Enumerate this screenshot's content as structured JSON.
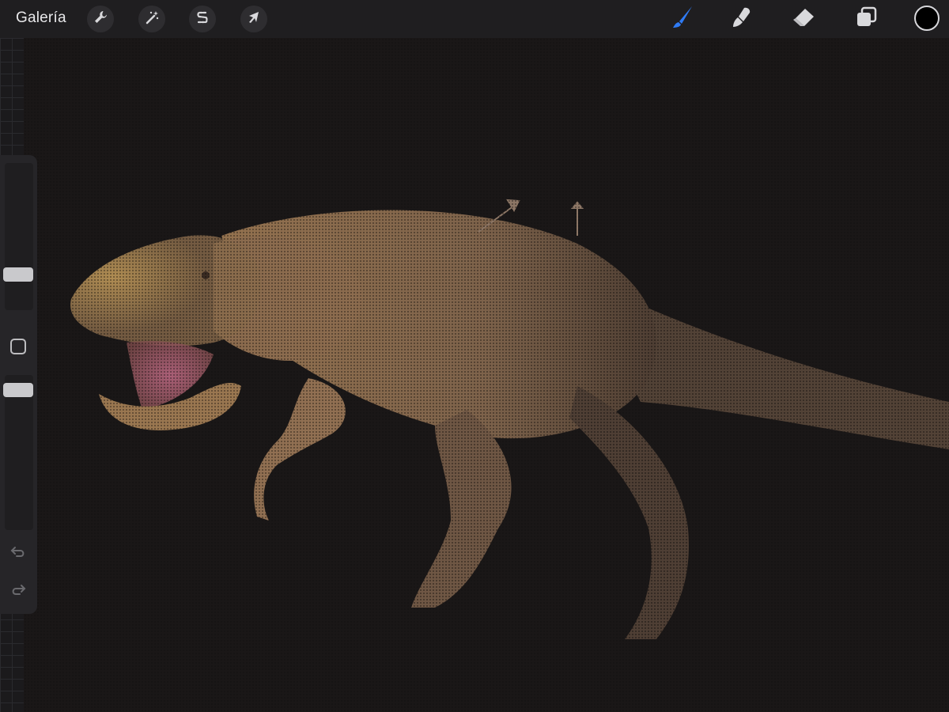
{
  "toolbar": {
    "gallery_label": "Galería",
    "left_tools": [
      {
        "name": "actions",
        "icon": "wrench-icon"
      },
      {
        "name": "adjustments",
        "icon": "magic-wand-icon"
      },
      {
        "name": "selection",
        "icon": "selection-s-icon"
      },
      {
        "name": "transform",
        "icon": "cursor-arrow-icon"
      }
    ],
    "right_tools": [
      {
        "name": "brush",
        "icon": "brush-icon",
        "active": true
      },
      {
        "name": "smudge",
        "icon": "smudge-icon",
        "active": false
      },
      {
        "name": "eraser",
        "icon": "eraser-icon",
        "active": false
      },
      {
        "name": "layers",
        "icon": "layers-icon",
        "active": false
      }
    ],
    "current_color": "#000000"
  },
  "sidebar": {
    "brush_size_icon": "size-slider",
    "modify_icon": "square-icon",
    "brush_opacity_icon": "opacity-slider",
    "undo_icon": "undo-icon",
    "redo_icon": "redo-icon"
  },
  "canvas": {
    "subject": "artwork",
    "background_color": "#1a1717",
    "accent_color": "#b08a5a"
  },
  "colors": {
    "toolbar_bg": "#1f1e20",
    "active_tool": "#2f7bf5",
    "icon": "#d9d9dc"
  }
}
